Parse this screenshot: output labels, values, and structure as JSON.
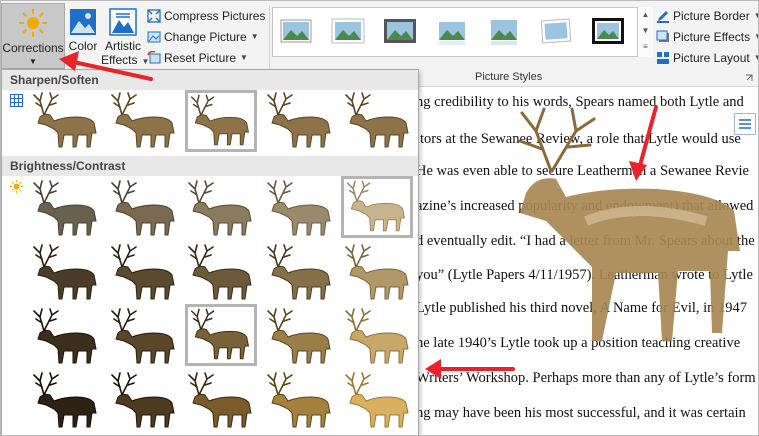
{
  "ribbon": {
    "corrections_label": "Corrections",
    "color_label": "Color",
    "artistic_label_1": "Artistic",
    "artistic_label_2": "Effects",
    "compress_label": "Compress Pictures",
    "change_label": "Change Picture",
    "reset_label": "Reset Picture",
    "picture_styles_label": "Picture Styles",
    "picture_border_label": "Picture Border",
    "picture_effects_label": "Picture Effects",
    "picture_layout_label": "Picture Layout"
  },
  "panel": {
    "sharpen_header": "Sharpen/Soften",
    "brightness_header": "Brightness/Contrast"
  },
  "document": {
    "lines": [
      "ng credibility to his words, Spears named both Lytle and",
      "itors at the Sewanee Review, a role that Lytle would use",
      "He was even able to secure Leatherman a Sewanee Revie",
      "azine’s increased popularity and endowment) that allowed",
      "d eventually edit. “I had a letter from Mr. Spears about the",
      "you” (Lytle Papers 4/11/1957). Leatherman wrote to Lytle",
      "Lytle published his third novel, A Name for Evil, in 1947",
      "he late 1940’s Lytle took up a position teaching creative",
      "Writers’ Workshop.  Perhaps more than any of Lytle’s form",
      "ng may have been his most successful, and it was certain"
    ]
  },
  "colors": {
    "accent_red": "#e8232a",
    "ribbon_bg": "#f3f3f3",
    "selected_bg": "#c8c8c8"
  }
}
